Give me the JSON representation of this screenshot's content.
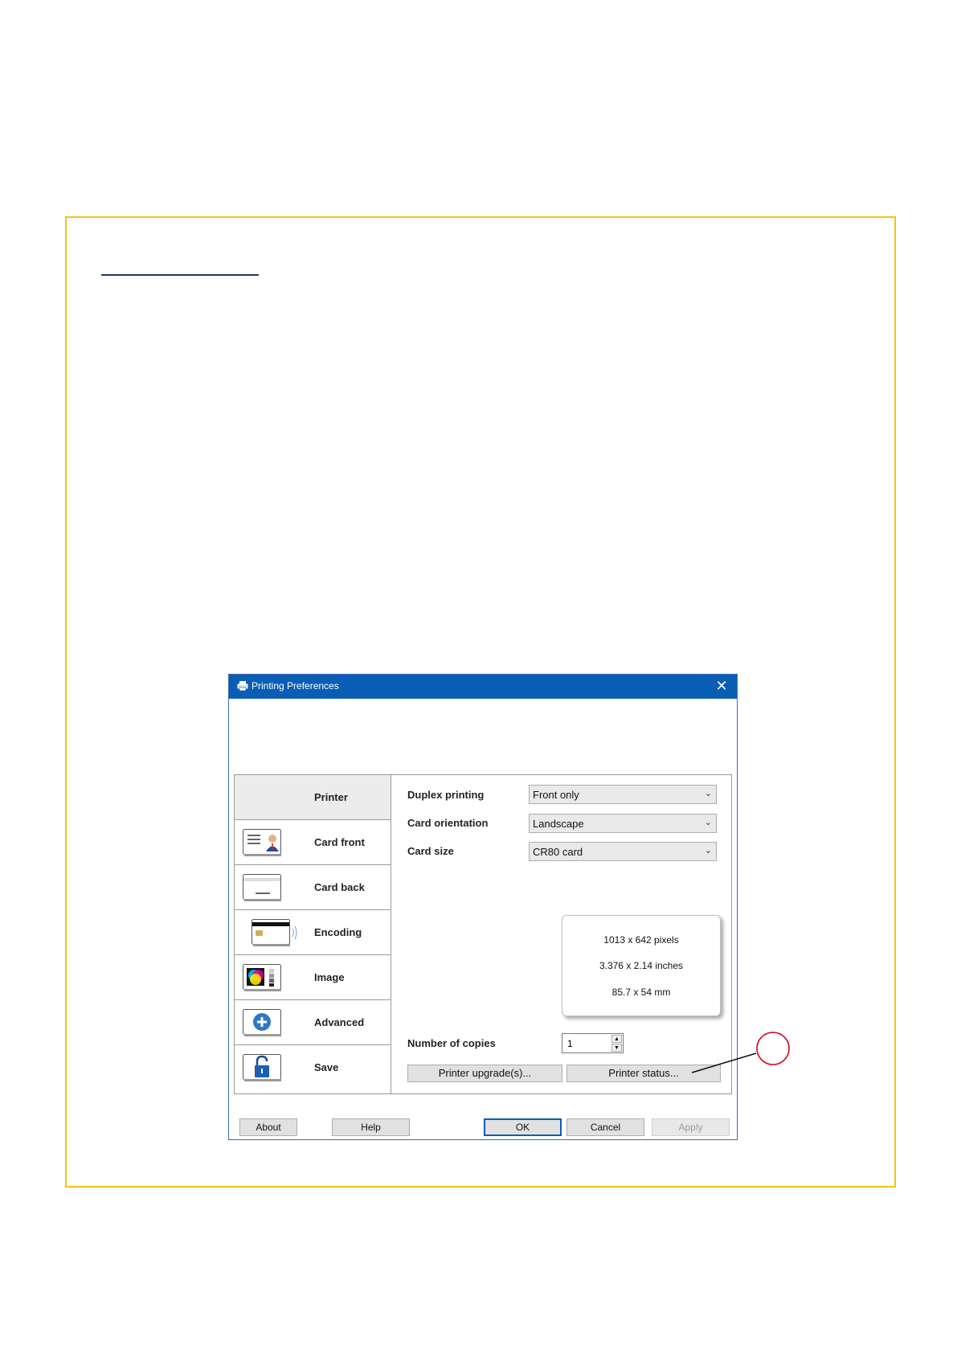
{
  "dialog": {
    "title": "Printing Preferences",
    "close_glyph": "✕",
    "title_icon": "printer-icon"
  },
  "sidebar": {
    "items": [
      {
        "label": "Printer",
        "icon": "",
        "selected": true
      },
      {
        "label": "Card front",
        "icon": "card-front-icon",
        "selected": false
      },
      {
        "label": "Card back",
        "icon": "card-back-icon",
        "selected": false
      },
      {
        "label": "Encoding",
        "icon": "encoding-icon",
        "selected": false
      },
      {
        "label": "Image",
        "icon": "image-icon",
        "selected": false
      },
      {
        "label": "Advanced",
        "icon": "advanced-plus-icon",
        "selected": false
      },
      {
        "label": "Save",
        "icon": "lock-icon",
        "selected": false
      }
    ]
  },
  "settings": {
    "duplex_label": "Duplex printing",
    "duplex_value": "Front only",
    "orientation_label": "Card orientation",
    "orientation_value": "Landscape",
    "size_label": "Card size",
    "size_value": "CR80 card",
    "copies_label": "Number of copies",
    "copies_value": "1"
  },
  "card_dimensions": {
    "pixels": "1013 x 642 pixels",
    "inches": "3.376 x 2.14 inches",
    "mm": "85.7 x 54 mm"
  },
  "buttons": {
    "upgrade": "Printer upgrade(s)...",
    "status": "Printer status...",
    "about": "About",
    "help": "Help",
    "ok": "OK",
    "cancel": "Cancel",
    "apply": "Apply"
  },
  "colors": {
    "frame_border": "#f1c40f",
    "titlebar": "#0a5db5",
    "annotation": "#d0021b"
  }
}
